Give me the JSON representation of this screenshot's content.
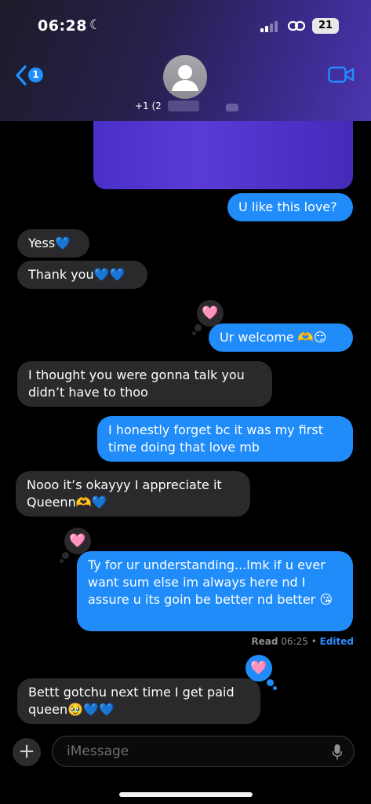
{
  "status_bar": {
    "time": "06:28",
    "battery": "21"
  },
  "header": {
    "back_badge": "1",
    "contact_name": "+1 (2"
  },
  "messages": [
    {
      "side": "out",
      "text": "U like this love?"
    },
    {
      "side": "in",
      "text": "Yess💙"
    },
    {
      "side": "in",
      "text": "Thank you💙💙"
    },
    {
      "side": "out",
      "text": "Ur welcome 🫶😏",
      "reaction": "🩷"
    },
    {
      "side": "in",
      "text": "I thought you were gonna talk you didn’t have to thoo"
    },
    {
      "side": "out",
      "text": "I honestly forget bc it was my first time doing that love mb"
    },
    {
      "side": "in",
      "text": "Nooo it’s okayyy I appreciate it Queenn🫶💙"
    },
    {
      "side": "out",
      "text": "Ty for ur understanding...lmk if u ever want sum else im always here nd I assure u its goin be better nd better 😘",
      "reaction": "🩷"
    },
    {
      "side": "in",
      "text": "Bettt gotchu next time I get paid queen🥹💙💙",
      "reaction": "🩷"
    }
  ],
  "read_receipt": {
    "label": "Read",
    "time": "06:25",
    "separator": "•",
    "edited": "Edited"
  },
  "composer": {
    "placeholder": "iMessage",
    "plus": "+"
  },
  "colors": {
    "incoming": "#2a2a2c",
    "outgoing": "#1f8cf9",
    "header_accent": "#4b36b0"
  }
}
